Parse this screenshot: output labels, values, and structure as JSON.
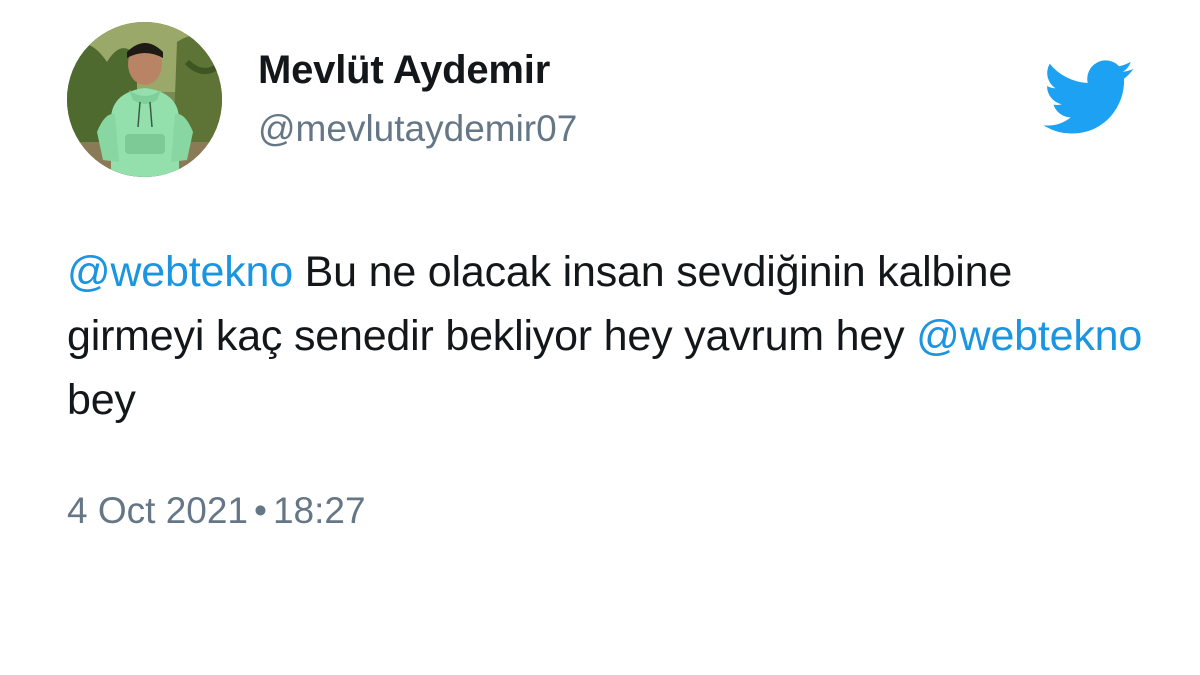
{
  "author": {
    "display_name": "Mevlüt Aydemir",
    "handle": "@mevlutaydemir07"
  },
  "icons": {
    "brand": "twitter-bird-icon"
  },
  "colors": {
    "mention": "#1b95e0",
    "brand": "#1da1f2",
    "secondary_text": "#657786",
    "primary_text": "#14171a"
  },
  "tweet": {
    "mention_1": "@webtekno",
    "text_1": " Bu ne olacak insan sevdiğinin kalbine girmeyi kaç senedir bekliyor hey yavrum hey ",
    "mention_2": "@webtekno",
    "text_2": " bey"
  },
  "meta": {
    "date": "4 Oct 2021",
    "separator": "•",
    "time": "18:27"
  }
}
